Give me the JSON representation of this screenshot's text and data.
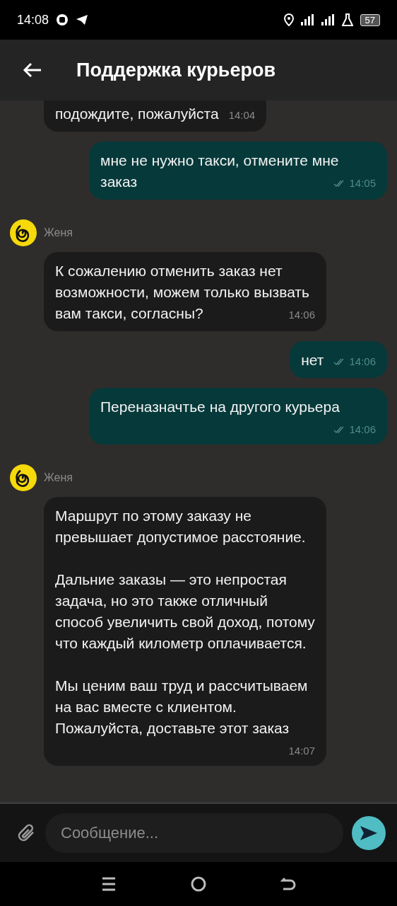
{
  "status_bar": {
    "time": "14:08",
    "battery": "57"
  },
  "header": {
    "title": "Поддержка курьеров"
  },
  "messages": [
    {
      "kind": "incoming",
      "cut": true,
      "text": "подождите, пожалуйста",
      "time": "14:04"
    },
    {
      "kind": "outgoing",
      "text": "мне не нужно такси, отмените мне заказ",
      "time": "14:05",
      "read": true
    },
    {
      "kind": "sender",
      "name": "Женя"
    },
    {
      "kind": "incoming",
      "text": "К сожалению отменить заказ нет возможности, можем только вызвать вам такси, согласны?",
      "time": "14:06"
    },
    {
      "kind": "outgoing",
      "text": "нет",
      "time": "14:06",
      "read": true
    },
    {
      "kind": "outgoing",
      "text": "Переназначтье на другого курьера",
      "time": "14:06",
      "read": true
    },
    {
      "kind": "sender",
      "name": "Женя"
    },
    {
      "kind": "incoming",
      "text": "Маршрут по этому заказу не превышает допустимое расстояние.\n\nДальние заказы — это непростая задача, но это также отличный способ увеличить свой доход, потому что каждый километр оплачивается.\n\nМы ценим ваш труд и рассчитываем на вас вместе с клиентом. Пожалуйста, доставьте этот заказ",
      "time": "14:07"
    }
  ],
  "composer": {
    "placeholder": "Сообщение..."
  }
}
